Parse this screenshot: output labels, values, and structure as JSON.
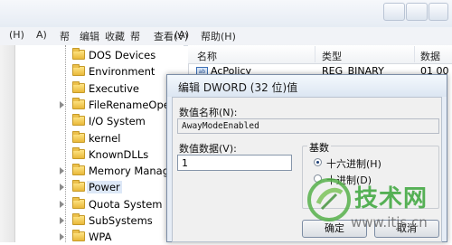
{
  "menubar": {
    "left_items": [
      "(H)",
      "A)",
      "帮",
      "编辑",
      "收藏",
      "帮",
      "查看(V)"
    ],
    "right_items": [
      "(A)",
      "帮助(H)"
    ]
  },
  "tree": {
    "items": [
      {
        "label": "DOS Devices"
      },
      {
        "label": "Environment"
      },
      {
        "label": "Executive"
      },
      {
        "label": "FileRenameOper"
      },
      {
        "label": "I/O System"
      },
      {
        "label": "kernel"
      },
      {
        "label": "KnownDLLs"
      },
      {
        "label": "Memory Manag"
      },
      {
        "label": "Power"
      },
      {
        "label": "Quota System"
      },
      {
        "label": "SubSystems"
      },
      {
        "label": "WPA"
      }
    ]
  },
  "list": {
    "col_name": "名称",
    "col_type": "类型",
    "col_data": "数据",
    "row1_name": "AcPolicy",
    "row1_type": "REG_BINARY",
    "row1_data": "01 00"
  },
  "dialog": {
    "title": "编辑 DWORD (32 位)值",
    "value_name_label": "数值名称(N):",
    "value_name": "AwayModeEnabled",
    "value_data_label": "数值数据(V):",
    "value_data": "1",
    "base_label": "基数",
    "hex_label": "十六进制(H)",
    "dec_label": "十进制(D)",
    "ok_label": "确定",
    "cancel_label": "取消"
  },
  "watermark": {
    "brand": "技术网",
    "url": "www.itjs.cn"
  },
  "colors": {
    "accent": "#1e3f76",
    "watermark_green": "#3aa53a"
  }
}
